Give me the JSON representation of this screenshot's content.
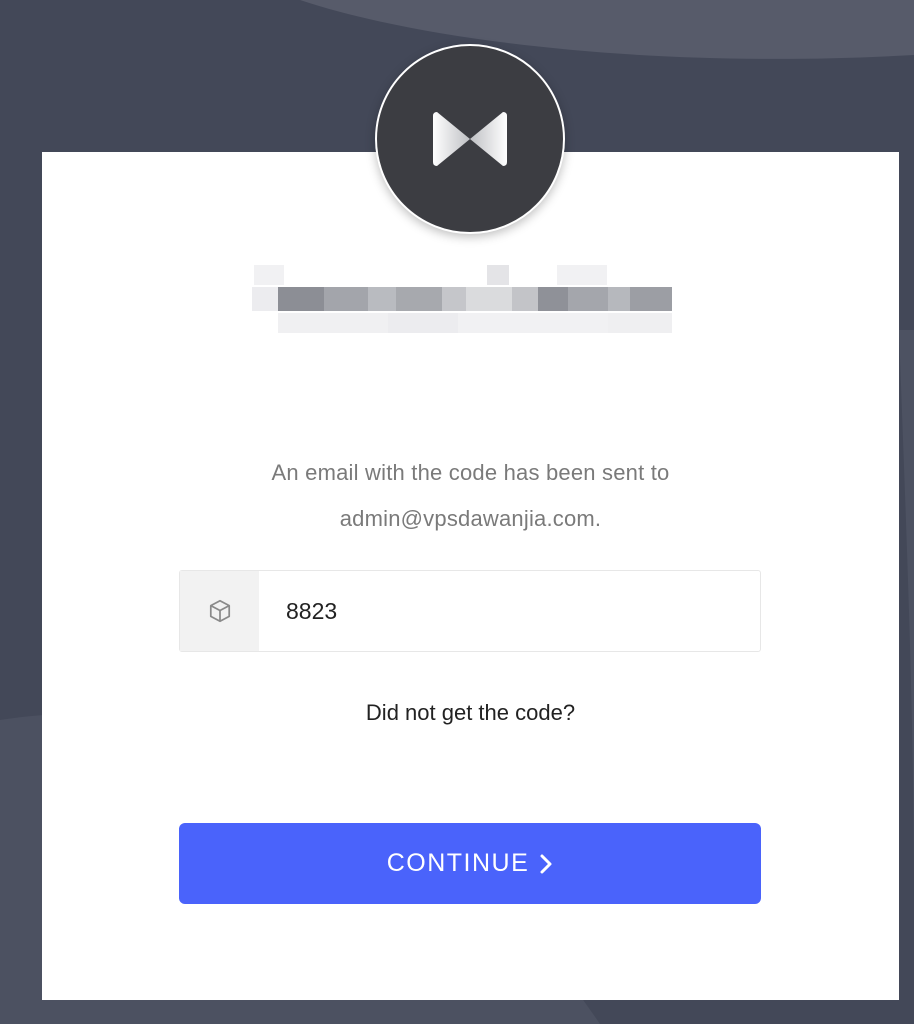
{
  "logo": {
    "icon": "bowtie-logo-icon"
  },
  "message": {
    "line1": "An email with the code has been sent to",
    "line2": "admin@vpsdawanjia.com."
  },
  "code_field": {
    "icon": "cube-icon",
    "value": "8823"
  },
  "resend_link": "Did not get the code?",
  "continue_button": {
    "label": "CONTINUE",
    "icon": "chevron-right-icon"
  },
  "colors": {
    "background": "#434858",
    "card": "#ffffff",
    "logo_circle": "#3c3d42",
    "primary": "#4a63fb",
    "muted_text": "#7a7a7a"
  }
}
